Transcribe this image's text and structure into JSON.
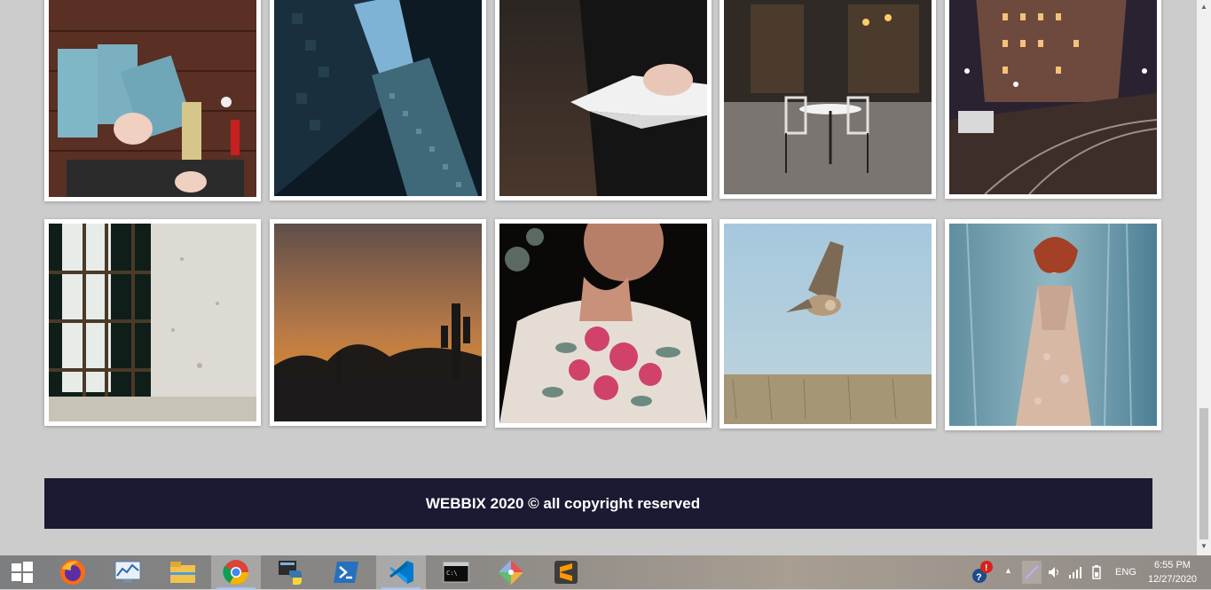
{
  "gallery": {
    "rows": [
      [
        {
          "name": "gift-wrapping-photo"
        },
        {
          "name": "skyscraper-photo"
        },
        {
          "name": "reading-book-photo"
        },
        {
          "name": "cafe-chairs-photo"
        },
        {
          "name": "night-street-photo"
        }
      ],
      [
        {
          "name": "window-wall-photo"
        },
        {
          "name": "desert-sunset-photo"
        },
        {
          "name": "bride-bouquet-photo"
        },
        {
          "name": "flying-owl-photo"
        },
        {
          "name": "fantasy-woman-photo"
        }
      ]
    ]
  },
  "footer": {
    "text": "WEBBIX 2020 © all copyright reserved"
  },
  "taskbar": {
    "apps": [
      {
        "name": "start-button",
        "icon": "windows-icon"
      },
      {
        "name": "firefox",
        "icon": "firefox-icon"
      },
      {
        "name": "task-manager",
        "icon": "performance-monitor-icon"
      },
      {
        "name": "file-explorer",
        "icon": "folder-icon"
      },
      {
        "name": "chrome",
        "icon": "chrome-icon"
      },
      {
        "name": "python",
        "icon": "python-icon"
      },
      {
        "name": "powershell",
        "icon": "powershell-icon"
      },
      {
        "name": "vscode",
        "icon": "vscode-icon"
      },
      {
        "name": "command-prompt",
        "icon": "cmd-icon"
      },
      {
        "name": "git",
        "icon": "git-icon"
      },
      {
        "name": "sublime-text",
        "icon": "sublime-icon"
      }
    ],
    "tray": {
      "language": "ENG",
      "time": "6:55 PM",
      "date": "12/27/2020"
    }
  }
}
